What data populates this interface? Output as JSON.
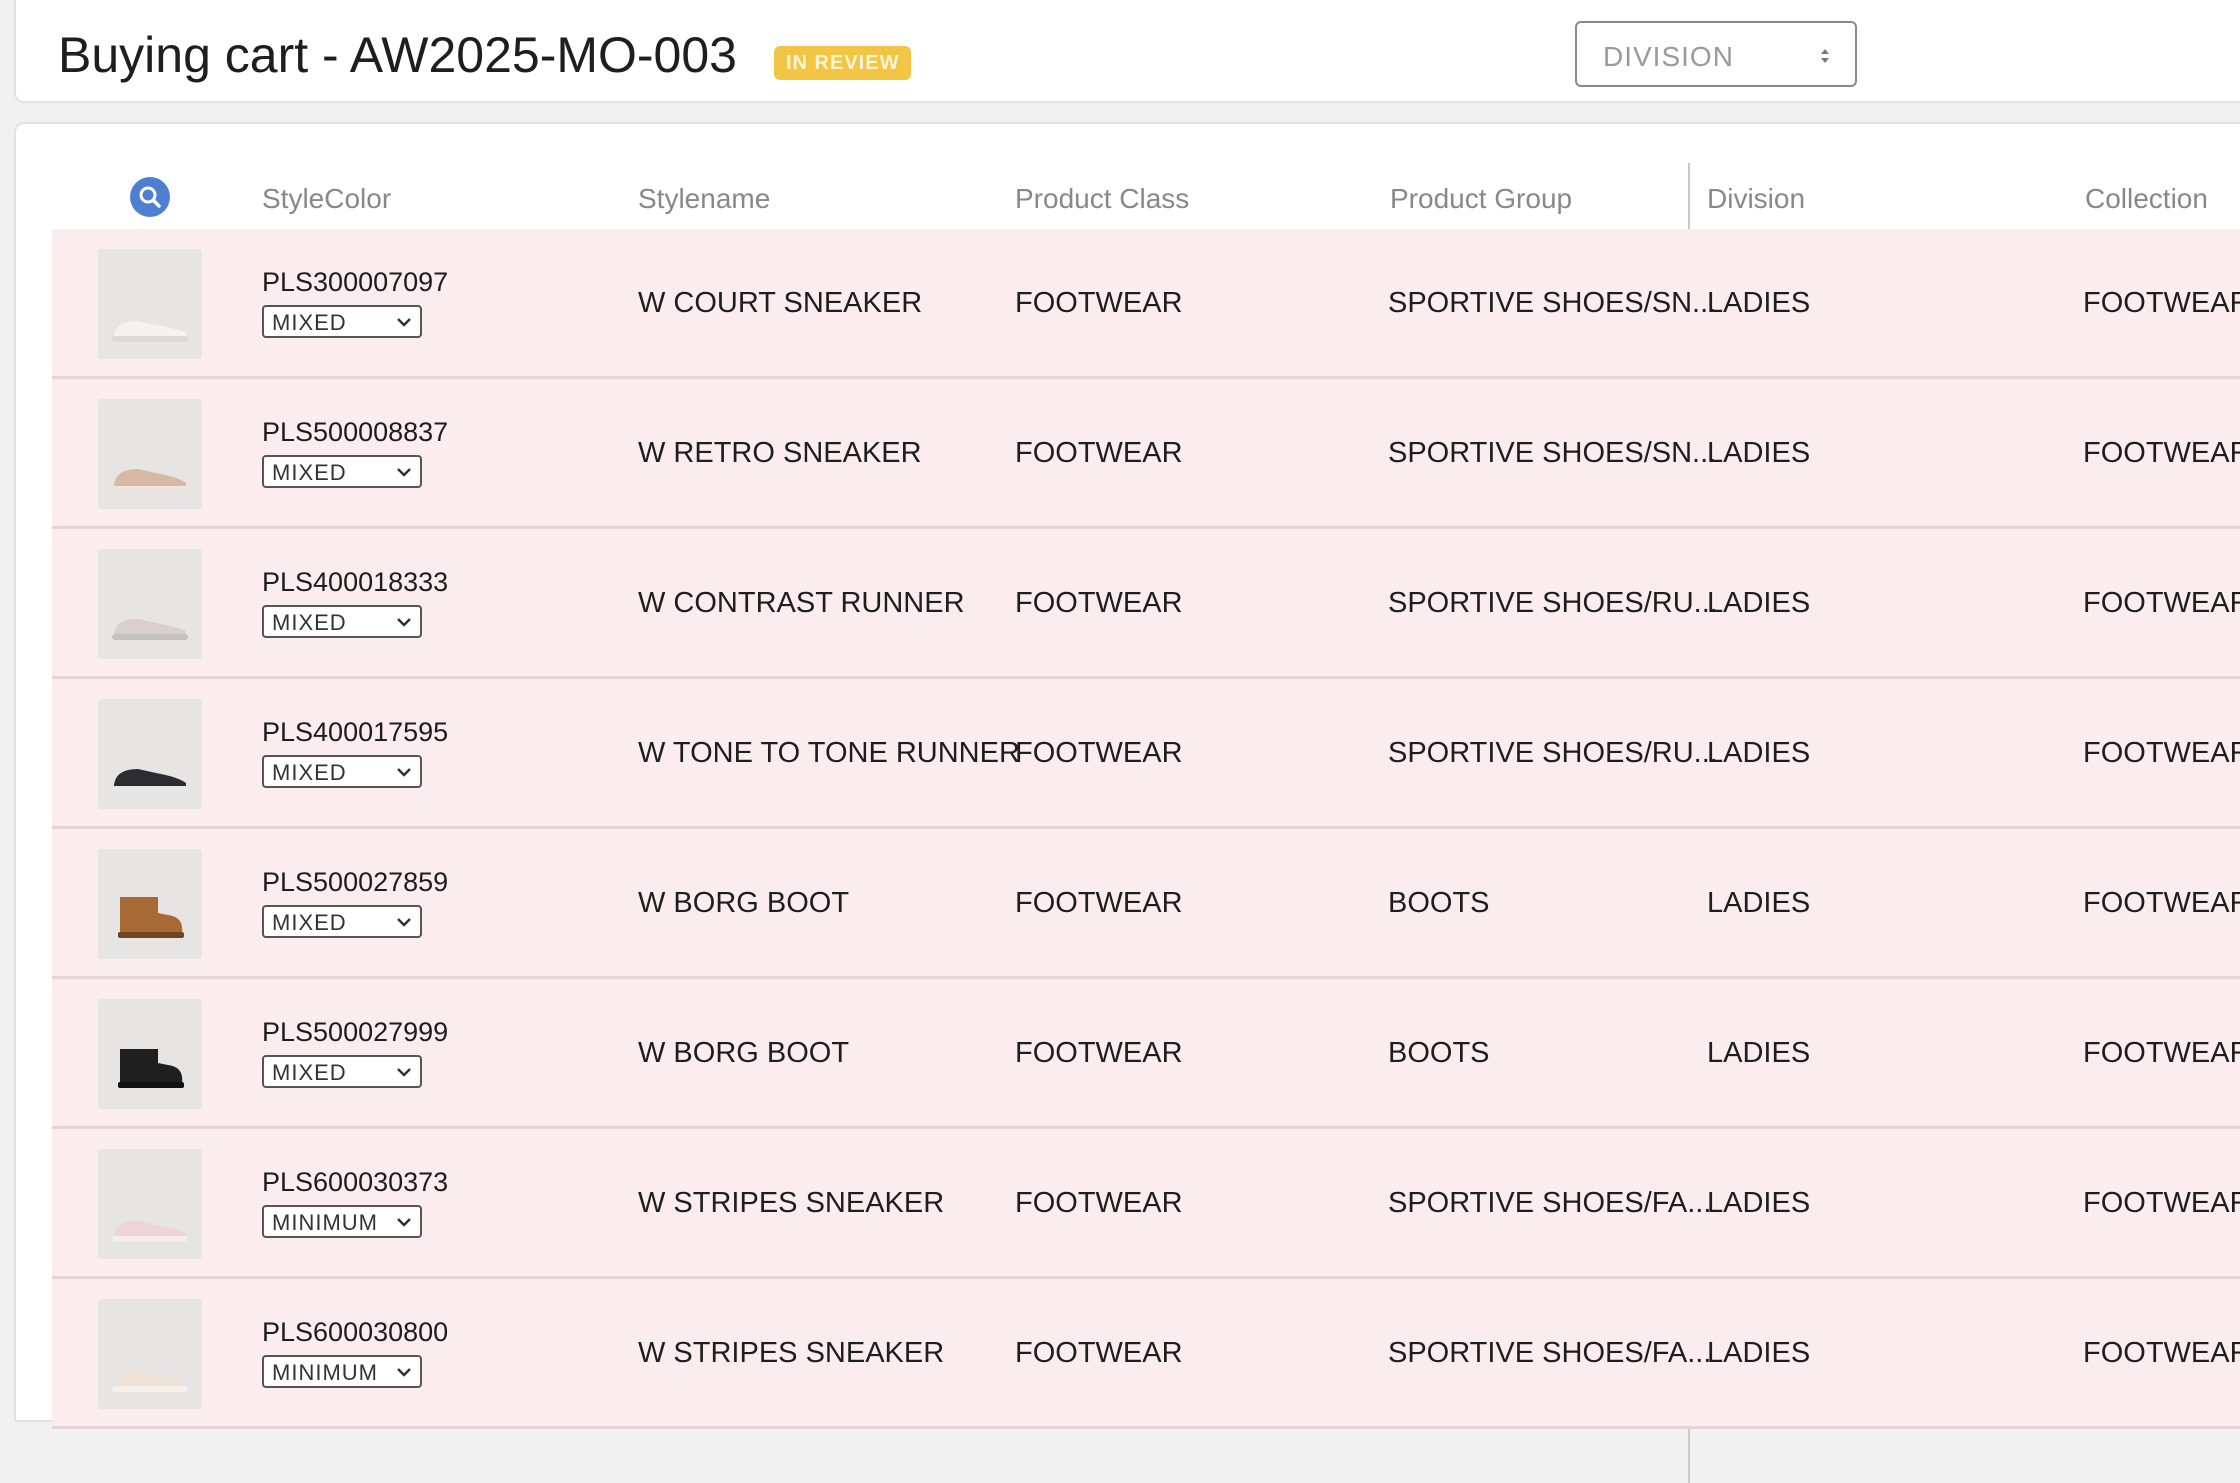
{
  "header": {
    "title": "Buying cart - AW2025-MO-003",
    "badge": "IN REVIEW",
    "division_select": "DIVISION"
  },
  "table": {
    "columns": [
      "StyleColor",
      "Stylename",
      "Product Class",
      "Product Group",
      "Division",
      "Collection"
    ],
    "rows": [
      {
        "stylecolor": "PLS300007097",
        "option": "MIXED",
        "stylename": "W COURT SNEAKER",
        "product_class": "FOOTWEAR",
        "product_group": "SPORTIVE SHOES/SN...",
        "division": "LADIES",
        "collection": "FOOTWEAR",
        "shoe": "white-sneaker"
      },
      {
        "stylecolor": "PLS500008837",
        "option": "MIXED",
        "stylename": "W RETRO SNEAKER",
        "product_class": "FOOTWEAR",
        "product_group": "SPORTIVE SHOES/SN...",
        "division": "LADIES",
        "collection": "FOOTWEAR",
        "shoe": "beige-sneaker"
      },
      {
        "stylecolor": "PLS400018333",
        "option": "MIXED",
        "stylename": "W CONTRAST RUNNER",
        "product_class": "FOOTWEAR",
        "product_group": "SPORTIVE SHOES/RU...",
        "division": "LADIES",
        "collection": "FOOTWEAR",
        "shoe": "grey-runner"
      },
      {
        "stylecolor": "PLS400017595",
        "option": "MIXED",
        "stylename": "W TONE TO TONE RUNNER",
        "product_class": "FOOTWEAR",
        "product_group": "SPORTIVE SHOES/RU...",
        "division": "LADIES",
        "collection": "FOOTWEAR",
        "shoe": "black-runner"
      },
      {
        "stylecolor": "PLS500027859",
        "option": "MIXED",
        "stylename": "W BORG BOOT",
        "product_class": "FOOTWEAR",
        "product_group": "BOOTS",
        "division": "LADIES",
        "collection": "FOOTWEAR",
        "shoe": "tan-boot"
      },
      {
        "stylecolor": "PLS500027999",
        "option": "MIXED",
        "stylename": "W BORG BOOT",
        "product_class": "FOOTWEAR",
        "product_group": "BOOTS",
        "division": "LADIES",
        "collection": "FOOTWEAR",
        "shoe": "black-boot"
      },
      {
        "stylecolor": "PLS600030373",
        "option": "MINIMUM",
        "stylename": "W STRIPES SNEAKER",
        "product_class": "FOOTWEAR",
        "product_group": "SPORTIVE SHOES/FA...",
        "division": "LADIES",
        "collection": "FOOTWEAR",
        "shoe": "pink-sneaker"
      },
      {
        "stylecolor": "PLS600030800",
        "option": "MINIMUM",
        "stylename": "W STRIPES SNEAKER",
        "product_class": "FOOTWEAR",
        "product_group": "SPORTIVE SHOES/FA...",
        "division": "LADIES",
        "collection": "FOOTWEAR",
        "shoe": "cream-sneaker"
      }
    ]
  },
  "colors": {
    "row_bg": "#fbeded",
    "badge": "#f3c544",
    "search_icon": "#4f7fd1"
  }
}
